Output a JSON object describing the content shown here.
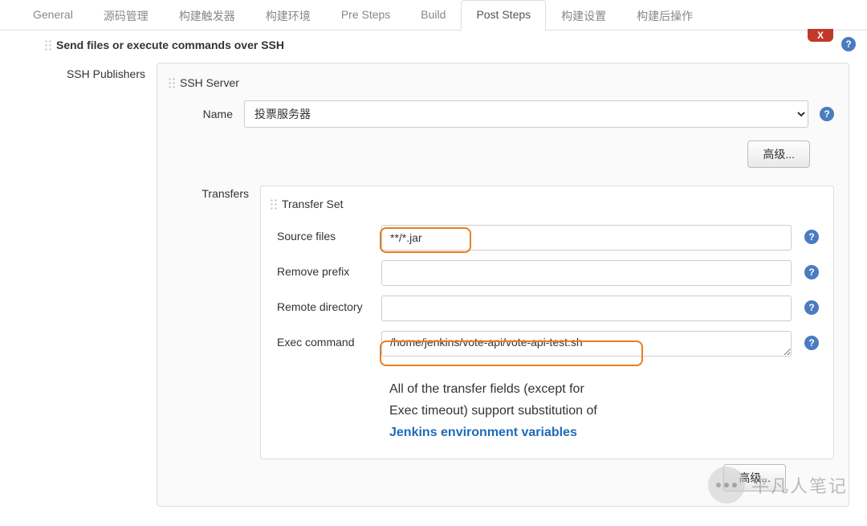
{
  "tabs": {
    "general": "General",
    "scm": "源码管理",
    "triggers": "构建触发器",
    "env": "构建环境",
    "pre_steps": "Pre Steps",
    "build": "Build",
    "post_steps": "Post Steps",
    "settings": "构建设置",
    "post_actions": "构建后操作"
  },
  "section": {
    "title": "Send files or execute commands over SSH",
    "close": "X",
    "publishers_label": "SSH Publishers",
    "ssh_server_label": "SSH Server",
    "name_label": "Name",
    "server_name": "投票服务器",
    "advanced_btn": "高级...",
    "transfers_label": "Transfers",
    "transfer_set_label": "Transfer Set",
    "fields": {
      "source_files": {
        "label": "Source files",
        "value": "**/*.jar"
      },
      "remove_prefix": {
        "label": "Remove prefix",
        "value": ""
      },
      "remote_dir": {
        "label": "Remote directory",
        "value": ""
      },
      "exec_cmd": {
        "label": "Exec command",
        "value": "/home/jenkins/vote-api/vote-api-test.sh"
      }
    },
    "note_pre": "All of the transfer fields (except for Exec timeout) support substitution of ",
    "note_link": "Jenkins environment variables"
  },
  "watermark": "平凡人笔记",
  "help_glyph": "?"
}
